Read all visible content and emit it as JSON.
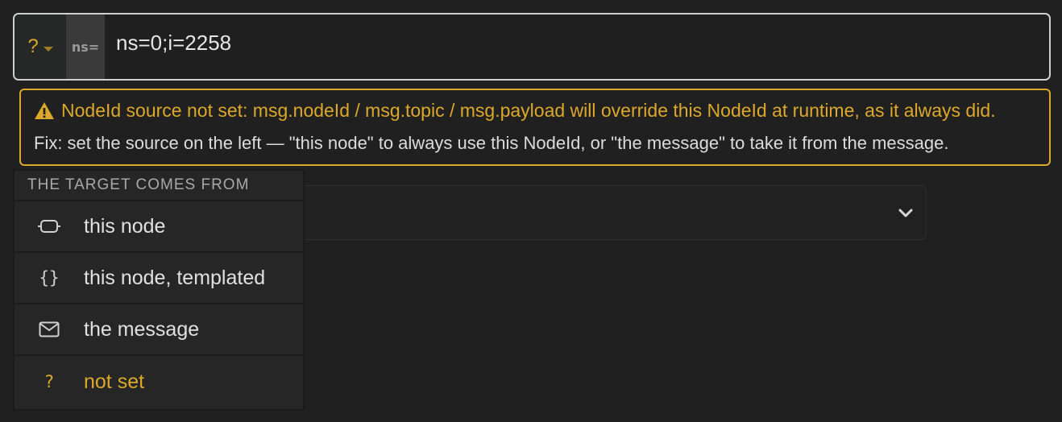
{
  "input": {
    "source_symbol": "?",
    "ns_prefix": "ns=",
    "value": "ns=0;i=2258"
  },
  "warning": {
    "line1": "NodeId source not set: msg.nodeId / msg.topic / msg.payload will override this NodeId at runtime, as it always did.",
    "line2": "Fix: set the source on the left — \"this node\" to always use this NodeId, or \"the message\" to take it from the message."
  },
  "menu": {
    "header": "THE TARGET COMES FROM",
    "items": [
      {
        "icon": "node-icon",
        "label": "this node"
      },
      {
        "icon": "braces-icon",
        "glyph": "{}",
        "label": "this node, templated"
      },
      {
        "icon": "envelope-icon",
        "label": "the message"
      },
      {
        "icon": "question-icon",
        "glyph": "?",
        "label": "not set"
      }
    ]
  },
  "colors": {
    "accent": "#dba82b",
    "background": "#202020",
    "text": "#d4d4d4"
  }
}
